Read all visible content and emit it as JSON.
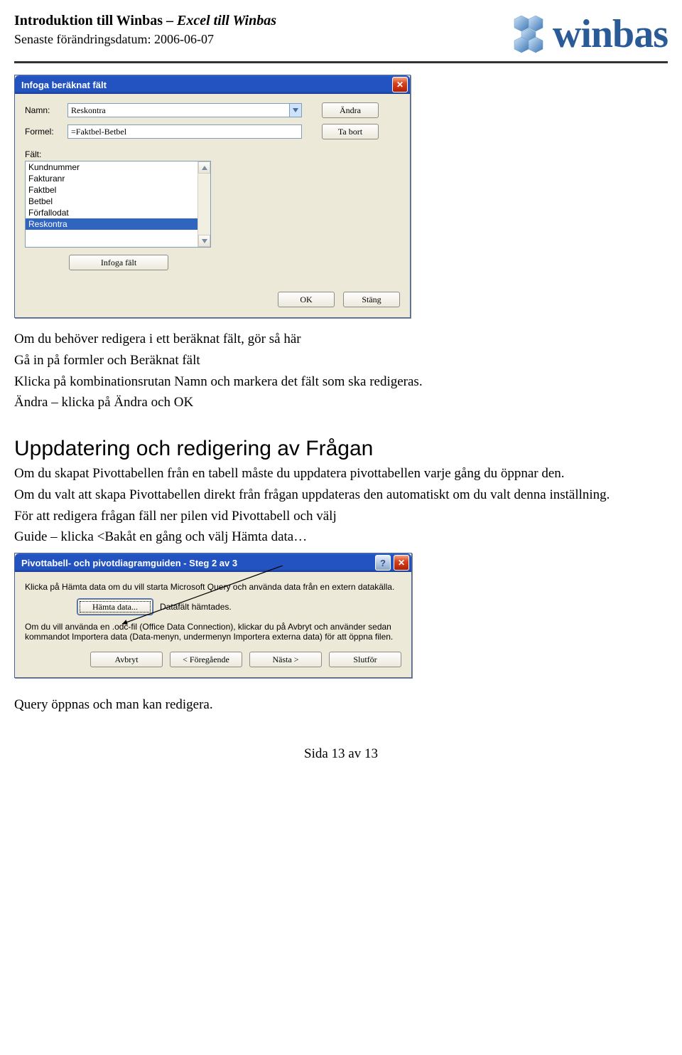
{
  "header": {
    "title_bold": "Introduktion till Winbas – ",
    "title_italic": "Excel till Winbas",
    "date_line": "Senaste förändringsdatum: 2006-06-07",
    "logo_text": "winbas"
  },
  "dialog1": {
    "title": "Infoga beräknat fält",
    "name_label": "Namn:",
    "name_value": "Reskontra",
    "formula_label": "Formel:",
    "formula_value": "=Faktbel-Betbel",
    "change_btn": "Ändra",
    "delete_btn": "Ta bort",
    "fields_label": "Fält:",
    "fields": [
      "Kundnummer",
      "Fakturanr",
      "Faktbel",
      "Betbel",
      "Förfallodat",
      "Reskontra"
    ],
    "insert_btn": "Infoga fält",
    "ok": "OK",
    "close": "Stäng"
  },
  "text": {
    "p1": "Om du behöver redigera i ett beräknat fält, gör så här",
    "p2": "Gå in på formler och Beräknat fält",
    "p3": "Klicka på kombinationsrutan Namn och markera det fält som ska redigeras.",
    "p4": "Ändra – klicka på Ändra och OK",
    "h2": "Uppdatering och redigering av Frågan",
    "p5": "Om du skapat Pivottabellen från en tabell måste du uppdatera pivottabellen varje gång du öppnar den.",
    "p6": "Om du valt att skapa Pivottabellen direkt från frågan uppdateras den automatiskt om du valt denna inställning.",
    "p7": "För att redigera frågan fäll ner pilen vid Pivottabell och välj",
    "p8": "Guide – klicka <Bakåt en gång och välj Hämta data…",
    "p9": "Query öppnas och man kan redigera."
  },
  "dialog2": {
    "title": "Pivottabell- och pivotdiagramguiden - Steg 2 av 3",
    "para1": "Klicka på Hämta data om du vill starta Microsoft Query och använda data från en extern datakälla.",
    "fetch_btn": "Hämta data...",
    "fetch_status": "Datafält hämtades.",
    "para2": "Om du vill använda en .odc-fil (Office Data Connection), klickar du på Avbryt och använder sedan kommandot Importera data (Data-menyn, undermenyn Importera externa data) för att öppna filen.",
    "cancel": "Avbryt",
    "prev": "< Föregående",
    "next": "Nästa >",
    "finish": "Slutför"
  },
  "footer": "Sida 13 av 13"
}
